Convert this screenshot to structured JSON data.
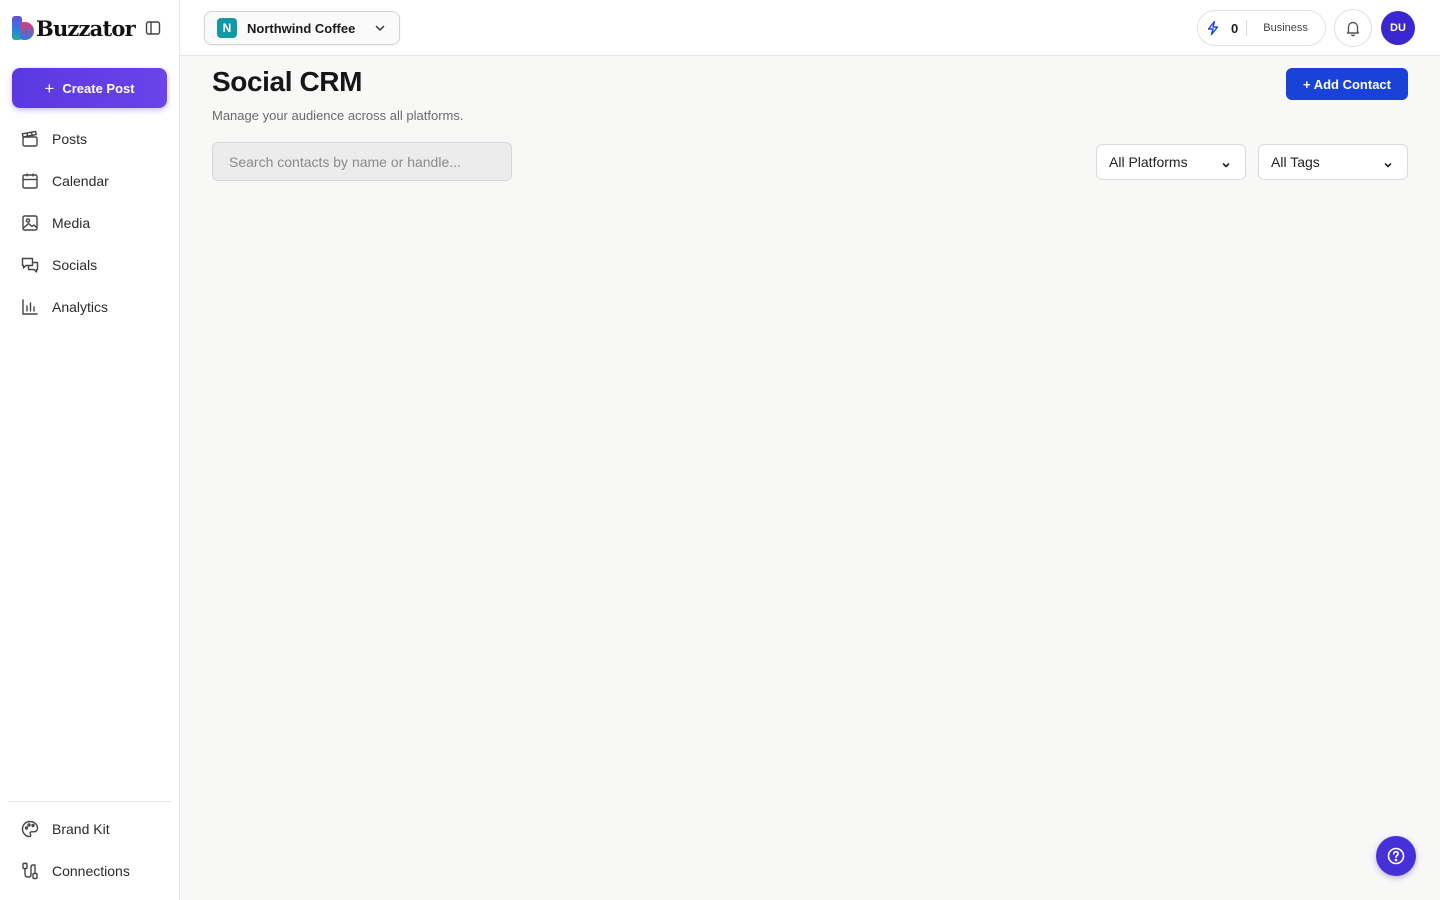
{
  "brand": {
    "name": "Buzzator"
  },
  "sidebar": {
    "create_label": "Create Post",
    "items": [
      {
        "label": "Posts",
        "icon": "clapperboard-icon"
      },
      {
        "label": "Calendar",
        "icon": "calendar-icon"
      },
      {
        "label": "Media",
        "icon": "image-icon"
      },
      {
        "label": "Socials",
        "icon": "chat-bubbles-icon"
      },
      {
        "label": "Analytics",
        "icon": "bar-chart-icon"
      }
    ],
    "bottom_items": [
      {
        "label": "Brand Kit",
        "icon": "palette-icon"
      },
      {
        "label": "Connections",
        "icon": "cable-icon"
      }
    ]
  },
  "header": {
    "workspace": {
      "initial": "N",
      "name": "Northwind Coffee",
      "badge_color": "#119aa6"
    },
    "credits": {
      "count": "0",
      "plan": "Business"
    },
    "avatar_initials": "DU"
  },
  "main": {
    "title": "Social CRM",
    "subtitle": "Manage your audience across all platforms.",
    "add_contact_label": "+ Add Contact",
    "search_placeholder": "Search contacts by name or handle...",
    "platform_filter": "All Platforms",
    "tag_filter": "All Tags"
  },
  "colors": {
    "accent": "#5b38e0",
    "primary_button": "#1942d8",
    "avatar": "#3b27cf"
  }
}
